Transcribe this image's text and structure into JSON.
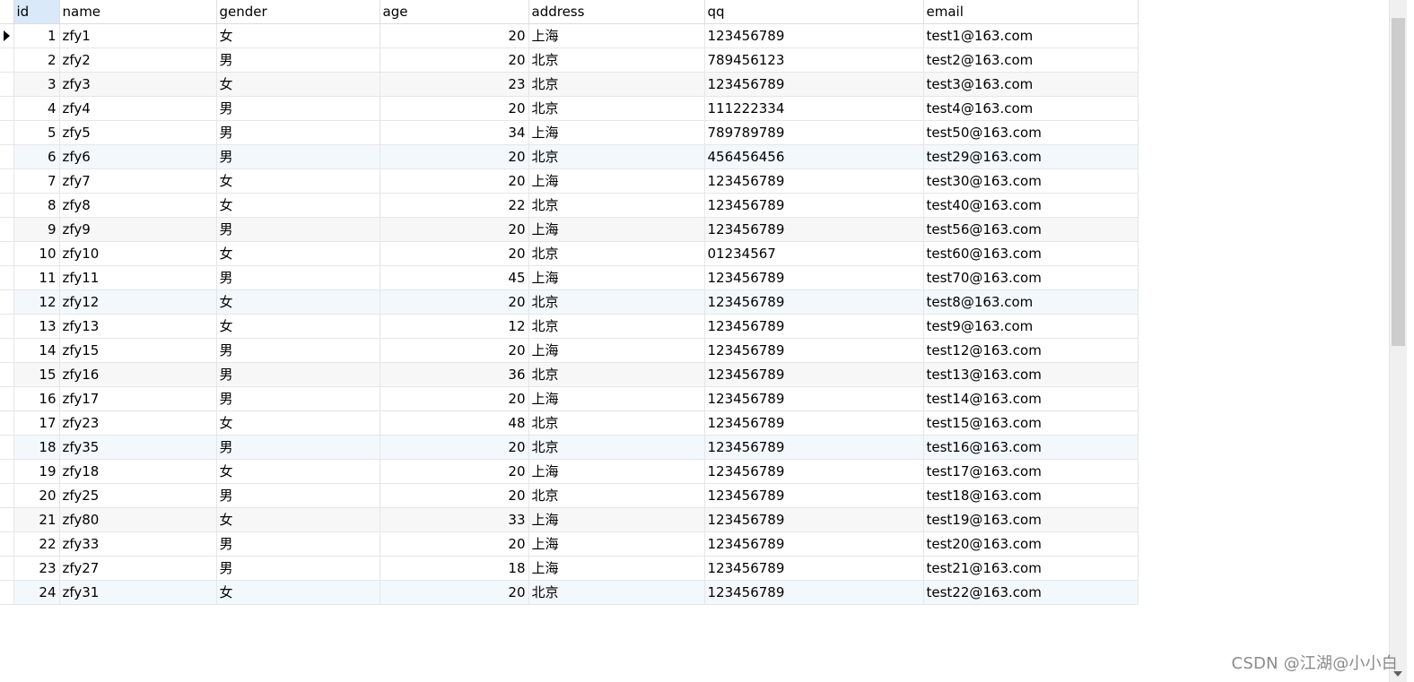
{
  "columns": [
    "id",
    "name",
    "gender",
    "age",
    "address",
    "qq",
    "email"
  ],
  "rows": [
    {
      "id": "1",
      "name": "zfy1",
      "gender": "女",
      "age": "20",
      "address": "上海",
      "qq": "123456789",
      "email": "test1@163.com"
    },
    {
      "id": "2",
      "name": "zfy2",
      "gender": "男",
      "age": "20",
      "address": "北京",
      "qq": "789456123",
      "email": "test2@163.com"
    },
    {
      "id": "3",
      "name": "zfy3",
      "gender": "女",
      "age": "23",
      "address": "北京",
      "qq": "123456789",
      "email": "test3@163.com"
    },
    {
      "id": "4",
      "name": "zfy4",
      "gender": "男",
      "age": "20",
      "address": "北京",
      "qq": "111222334",
      "email": "test4@163.com"
    },
    {
      "id": "5",
      "name": "zfy5",
      "gender": "男",
      "age": "34",
      "address": "上海",
      "qq": "789789789",
      "email": "test50@163.com"
    },
    {
      "id": "6",
      "name": "zfy6",
      "gender": "男",
      "age": "20",
      "address": "北京",
      "qq": "456456456",
      "email": "test29@163.com"
    },
    {
      "id": "7",
      "name": "zfy7",
      "gender": "女",
      "age": "20",
      "address": "上海",
      "qq": "123456789",
      "email": "test30@163.com"
    },
    {
      "id": "8",
      "name": "zfy8",
      "gender": "女",
      "age": "22",
      "address": "北京",
      "qq": "123456789",
      "email": "test40@163.com"
    },
    {
      "id": "9",
      "name": "zfy9",
      "gender": "男",
      "age": "20",
      "address": "上海",
      "qq": "123456789",
      "email": "test56@163.com"
    },
    {
      "id": "10",
      "name": "zfy10",
      "gender": "女",
      "age": "20",
      "address": "北京",
      "qq": "01234567",
      "email": "test60@163.com"
    },
    {
      "id": "11",
      "name": "zfy11",
      "gender": "男",
      "age": "45",
      "address": "上海",
      "qq": "123456789",
      "email": "test70@163.com"
    },
    {
      "id": "12",
      "name": "zfy12",
      "gender": "女",
      "age": "20",
      "address": "北京",
      "qq": "123456789",
      "email": "test8@163.com"
    },
    {
      "id": "13",
      "name": "zfy13",
      "gender": "女",
      "age": "12",
      "address": "北京",
      "qq": "123456789",
      "email": "test9@163.com"
    },
    {
      "id": "14",
      "name": "zfy15",
      "gender": "男",
      "age": "20",
      "address": "上海",
      "qq": "123456789",
      "email": "test12@163.com"
    },
    {
      "id": "15",
      "name": "zfy16",
      "gender": "男",
      "age": "36",
      "address": "北京",
      "qq": "123456789",
      "email": "test13@163.com"
    },
    {
      "id": "16",
      "name": "zfy17",
      "gender": "男",
      "age": "20",
      "address": "上海",
      "qq": "123456789",
      "email": "test14@163.com"
    },
    {
      "id": "17",
      "name": "zfy23",
      "gender": "女",
      "age": "48",
      "address": "北京",
      "qq": "123456789",
      "email": "test15@163.com"
    },
    {
      "id": "18",
      "name": "zfy35",
      "gender": "男",
      "age": "20",
      "address": "北京",
      "qq": "123456789",
      "email": "test16@163.com"
    },
    {
      "id": "19",
      "name": "zfy18",
      "gender": "女",
      "age": "20",
      "address": "上海",
      "qq": "123456789",
      "email": "test17@163.com"
    },
    {
      "id": "20",
      "name": "zfy25",
      "gender": "男",
      "age": "20",
      "address": "北京",
      "qq": "123456789",
      "email": "test18@163.com"
    },
    {
      "id": "21",
      "name": "zfy80",
      "gender": "女",
      "age": "33",
      "address": "上海",
      "qq": "123456789",
      "email": "test19@163.com"
    },
    {
      "id": "22",
      "name": "zfy33",
      "gender": "男",
      "age": "20",
      "address": "上海",
      "qq": "123456789",
      "email": "test20@163.com"
    },
    {
      "id": "23",
      "name": "zfy27",
      "gender": "男",
      "age": "18",
      "address": "上海",
      "qq": "123456789",
      "email": "test21@163.com"
    },
    {
      "id": "24",
      "name": "zfy31",
      "gender": "女",
      "age": "20",
      "address": "北京",
      "qq": "123456789",
      "email": "test22@163.com"
    }
  ],
  "current_row_index": 0,
  "selected_column": "id",
  "watermark": "CSDN @江湖@小小白",
  "colors": {
    "selected_header": "#d9e9f9",
    "alt_row": "#f7f7f7",
    "highlight_row": "#f3f8fd",
    "grid_line": "#e6e6e6",
    "scrollbar_thumb": "#cdcdcd"
  },
  "icons": {
    "row_pointer": "triangle-right-icon",
    "scroll_down": "chevron-down-icon"
  }
}
